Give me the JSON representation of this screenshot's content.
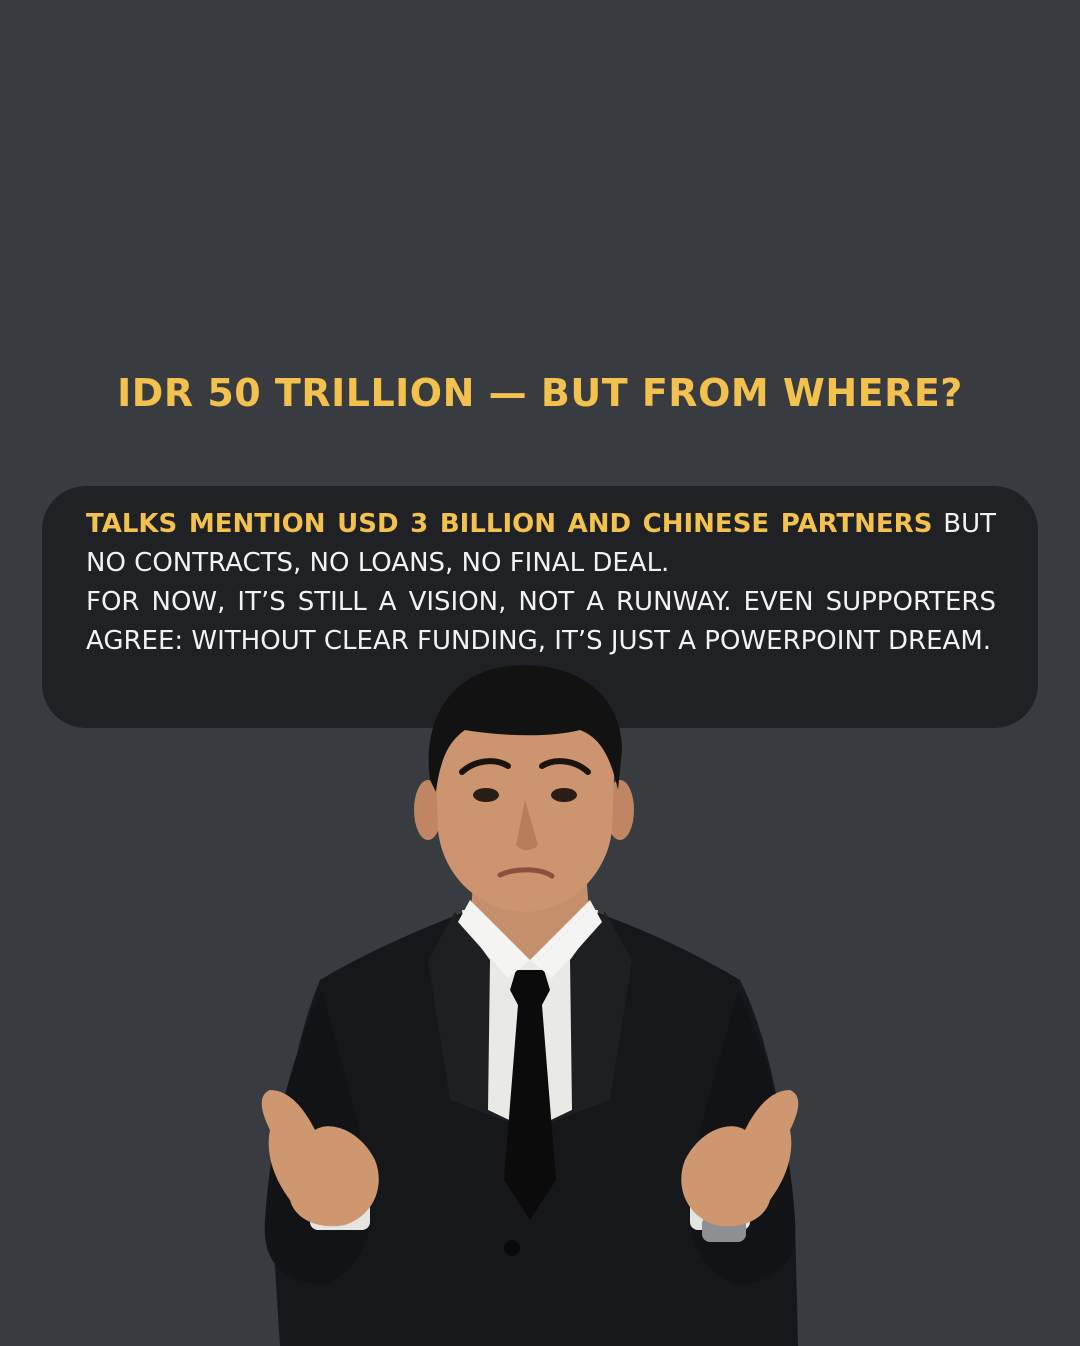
{
  "headline": "IDR 50 TRILLION — BUT FROM WHERE?",
  "bubble": {
    "highlight": "TALKS MENTION USD 3 BILLION AND CHINESE PARTNERS",
    "line1": " BUT NO CONTRACTS, NO LOANS, NO FINAL DEAL.",
    "line2": "FOR NOW, IT’S STILL A VISION, NOT A RUNWAY. EVEN SUPPORTERS AGREE: WITHOUT CLEAR FUNDING, IT’S JUST A POWERPOINT DREAM."
  },
  "colors": {
    "background": "#383b40",
    "accent": "#f2c14e",
    "bubble": "#1f2124",
    "text": "#f2f2f2"
  },
  "image": "confused-businessman-shrugging"
}
